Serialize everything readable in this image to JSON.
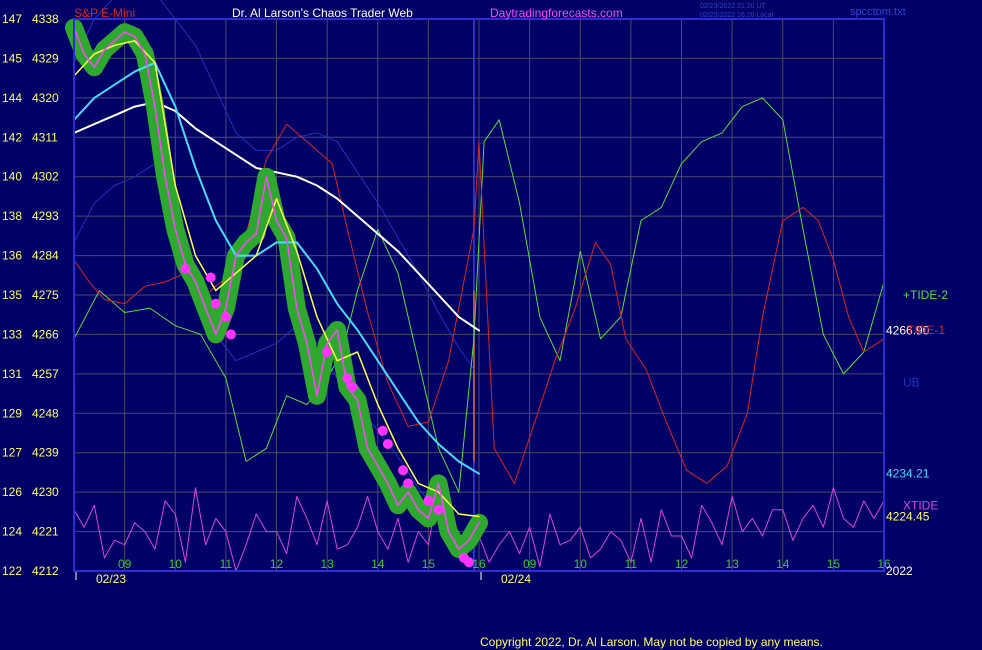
{
  "header": {
    "symbol": "S&P E-Mini",
    "title": "Dr. Al Larson's Chaos Trader Web",
    "site": "Daytradingforecasts.com",
    "stamp_line1": "02/23/2022 21:20 UT",
    "stamp_line2": "02/23/2022 16:20 Local",
    "file": "spcctom.txt"
  },
  "footer": {
    "copyright": "Copyright 2022, Dr. Al Larson. May not be copied by any means."
  },
  "colors": {
    "background": "#000066",
    "grid": "#4a4a6a",
    "frame": "#2b2bd8",
    "price": "#ff44ff",
    "price_glow": "#2ea82e",
    "ema_fast": "#ffff44",
    "ema_mid": "#44ddff",
    "ema_slow": "#ffffff",
    "band": "#2233bb",
    "tide_plus2": "#55dd44",
    "tide_minus1": "#dd2222",
    "xtide": "#dd44dd",
    "cursor": "#dd6622",
    "tick_text": "#ffff66",
    "hour_text": "#33cc33",
    "date_text": "#ffff66",
    "right_text": "#ffffff"
  },
  "chart_data": {
    "type": "line",
    "y_ticks": [
      {
        "index": "147",
        "price": "4338"
      },
      {
        "index": "145",
        "price": "4329"
      },
      {
        "index": "144",
        "price": "4320"
      },
      {
        "index": "142",
        "price": "4311"
      },
      {
        "index": "140",
        "price": "4302"
      },
      {
        "index": "138",
        "price": "4293"
      },
      {
        "index": "136",
        "price": "4284"
      },
      {
        "index": "135",
        "price": "4275"
      },
      {
        "index": "133",
        "price": "4266"
      },
      {
        "index": "131",
        "price": "4257"
      },
      {
        "index": "129",
        "price": "4248"
      },
      {
        "index": "127",
        "price": "4239"
      },
      {
        "index": "126",
        "price": "4230"
      },
      {
        "index": "124",
        "price": "4221"
      },
      {
        "index": "122",
        "price": "4212"
      }
    ],
    "ylim": [
      4212,
      4338
    ],
    "x_hour_ticks": [
      "09",
      "10",
      "11",
      "12",
      "13",
      "14",
      "15",
      "16",
      "09",
      "10",
      "11",
      "12",
      "13",
      "14",
      "15",
      "16"
    ],
    "x_dates": [
      "02/23",
      "02/24"
    ],
    "xlim": [
      8.0,
      24.0
    ],
    "now_x": 15.9,
    "legend": [
      {
        "label": "+TIDE-2",
        "color": "#55dd44"
      },
      {
        "label": "-TIDE-1",
        "color": "#dd2222"
      },
      {
        "label": "UB",
        "color": "#2233bb"
      },
      {
        "label": "XTIDE",
        "color": "#dd44dd"
      }
    ],
    "right_labels": [
      {
        "text": "4266.90",
        "value": 4266.9,
        "color": "#ffffff"
      },
      {
        "text": "4234.21",
        "value": 4234.21,
        "color": "#44ddff"
      },
      {
        "text": "4224.45",
        "value": 4224.45,
        "color": "#ffff66"
      },
      {
        "text": "2022",
        "value": 4212,
        "color": "#ffffff"
      }
    ],
    "series": [
      {
        "key": "price",
        "color": "#ff44ff",
        "x": [
          8.0,
          8.2,
          8.4,
          8.6,
          8.8,
          9.0,
          9.2,
          9.4,
          9.6,
          9.8,
          10.0,
          10.2,
          10.4,
          10.6,
          10.8,
          11.0,
          11.2,
          11.4,
          11.6,
          11.8,
          12.0,
          12.2,
          12.4,
          12.6,
          12.8,
          13.0,
          13.2,
          13.4,
          13.6,
          13.8,
          14.0,
          14.2,
          14.4,
          14.6,
          14.8,
          15.0,
          15.2,
          15.4,
          15.6,
          15.8,
          16.0
        ],
        "y": [
          4336,
          4330,
          4327,
          4331,
          4333,
          4335,
          4334,
          4330,
          4318,
          4302,
          4290,
          4282,
          4278,
          4272,
          4266,
          4272,
          4284,
          4287,
          4289,
          4302,
          4292,
          4288,
          4272,
          4264,
          4252,
          4264,
          4267,
          4254,
          4251,
          4240,
          4236,
          4232,
          4227,
          4230,
          4226,
          4224,
          4232,
          4221,
          4217,
          4219,
          4223
        ]
      },
      {
        "key": "ema_fast",
        "color": "#ffff44",
        "x": [
          8.0,
          8.4,
          8.8,
          9.2,
          9.6,
          10.0,
          10.4,
          10.8,
          11.2,
          11.6,
          12.0,
          12.4,
          12.8,
          13.2,
          13.6,
          14.0,
          14.4,
          14.8,
          15.2,
          15.6,
          16.0
        ],
        "y": [
          4325,
          4330,
          4332,
          4333,
          4328,
          4300,
          4284,
          4276,
          4280,
          4284,
          4297,
          4285,
          4270,
          4260,
          4262,
          4250,
          4240,
          4232,
          4230,
          4225,
          4224.45
        ]
      },
      {
        "key": "ema_mid",
        "color": "#44ddff",
        "x": [
          8.0,
          8.4,
          8.8,
          9.2,
          9.6,
          10.0,
          10.4,
          10.8,
          11.2,
          11.6,
          12.0,
          12.4,
          12.8,
          13.2,
          13.6,
          14.0,
          14.4,
          14.8,
          15.2,
          15.6,
          16.0
        ],
        "y": [
          4315,
          4320,
          4323,
          4326,
          4328,
          4318,
          4304,
          4292,
          4284,
          4284,
          4287,
          4287,
          4281,
          4273,
          4267,
          4260,
          4253,
          4246,
          4241,
          4237,
          4234.21
        ]
      },
      {
        "key": "ema_slow",
        "color": "#ffffff",
        "x": [
          8.0,
          8.4,
          8.8,
          9.2,
          9.6,
          10.0,
          10.4,
          10.8,
          11.2,
          11.6,
          12.0,
          12.4,
          12.8,
          13.2,
          13.6,
          14.0,
          14.4,
          14.8,
          15.2,
          15.6,
          16.0
        ],
        "y": [
          4312,
          4314,
          4316,
          4318,
          4319,
          4317,
          4313,
          4310,
          4307,
          4304,
          4303,
          4302,
          4300,
          4297,
          4293,
          4289,
          4285,
          4280,
          4275,
          4270,
          4266.9
        ]
      },
      {
        "key": "upper_band",
        "color": "#2233bb",
        "x": [
          8.0,
          8.4,
          8.8,
          9.2,
          9.6,
          10.0,
          10.4,
          10.8,
          11.2,
          11.6,
          12.0,
          12.4,
          12.8,
          13.2,
          13.6,
          14.0,
          14.4,
          14.8,
          15.2,
          15.6,
          15.9
        ],
        "y": [
          4328,
          4338,
          4343,
          4344,
          4344,
          4338,
          4332,
          4322,
          4312,
          4308,
          4308,
          4311,
          4312,
          4310,
          4303,
          4296,
          4288,
          4280,
          4271,
          4263,
          4258
        ]
      },
      {
        "key": "lower_band",
        "color": "#2233bb",
        "x": [
          8.0,
          8.4,
          8.8,
          9.2,
          9.6,
          10.0,
          10.4,
          10.8,
          11.2,
          11.6,
          12.0,
          12.4,
          12.8,
          13.2,
          13.6,
          14.0,
          14.4,
          14.8,
          15.2,
          15.6,
          15.9
        ],
        "y": [
          4287,
          4296,
          4300,
          4302,
          4305,
          4292,
          4276,
          4266,
          4260,
          4262,
          4264,
          4268,
          4264,
          4256,
          4250,
          4244,
          4238,
          4231,
          4225,
          4219,
          4216
        ]
      },
      {
        "key": "tide_plus2",
        "color": "#55dd44",
        "x": [
          8.0,
          8.5,
          9.0,
          9.5,
          10.0,
          10.5,
          11.0,
          11.4,
          11.8,
          12.2,
          12.6,
          13.0,
          13.3,
          13.6,
          14.0,
          14.4,
          14.8,
          15.2,
          15.6,
          15.9,
          16.1,
          16.4,
          16.8,
          17.2,
          17.6,
          18.0,
          18.4,
          18.8,
          19.2,
          19.6,
          20.0,
          20.4,
          20.8,
          21.2,
          21.6,
          22.0,
          22.4,
          22.8,
          23.2,
          23.6,
          24.0
        ],
        "y": [
          4265,
          4276,
          4271,
          4272,
          4268,
          4266,
          4256,
          4237,
          4240,
          4252,
          4250,
          4256,
          4262,
          4276,
          4290,
          4280,
          4260,
          4240,
          4230,
          4265,
          4310,
          4315,
          4296,
          4270,
          4260,
          4285,
          4265,
          4270,
          4292,
          4295,
          4305,
          4310,
          4312,
          4318,
          4320,
          4315,
          4290,
          4266,
          4257,
          4262,
          4278
        ]
      },
      {
        "key": "tide_minus1",
        "color": "#dd2222",
        "x": [
          8.0,
          8.3,
          8.6,
          9.0,
          9.4,
          9.8,
          10.2,
          10.6,
          11.0,
          11.4,
          11.8,
          12.2,
          12.5,
          12.8,
          13.1,
          13.4,
          13.8,
          14.2,
          14.6,
          15.0,
          15.4,
          15.9,
          16.0,
          16.3,
          16.7,
          17.1,
          17.5,
          17.9,
          18.3,
          18.6,
          18.9,
          19.3,
          19.7,
          20.1,
          20.5,
          20.9,
          21.3,
          21.6,
          22.0,
          22.4,
          22.7,
          23.0,
          23.3,
          23.6,
          24.0
        ],
        "y": [
          4283,
          4278,
          4274,
          4273,
          4277,
          4278,
          4280,
          4275,
          4279,
          4289,
          4306,
          4314,
          4311,
          4308,
          4305,
          4290,
          4271,
          4255,
          4245,
          4246,
          4260,
          4290,
          4310,
          4240,
          4232,
          4246,
          4260,
          4272,
          4287,
          4282,
          4265,
          4258,
          4246,
          4235,
          4232,
          4236,
          4248,
          4270,
          4292,
          4295,
          4292,
          4283,
          4270,
          4262,
          4265
        ]
      },
      {
        "key": "xtide",
        "color": "#dd44dd",
        "x": [
          8.0,
          8.2,
          8.4,
          8.6,
          8.8,
          9.0,
          9.2,
          9.4,
          9.6,
          9.8,
          10.0,
          10.2,
          10.4,
          10.6,
          10.8,
          11.0,
          11.2,
          11.4,
          11.6,
          11.8,
          12.0,
          12.2,
          12.4,
          12.6,
          12.8,
          13.0,
          13.2,
          13.4,
          13.6,
          13.8,
          14.0,
          14.2,
          14.4,
          14.6,
          14.8,
          15.0,
          15.2,
          15.4,
          15.6,
          15.8,
          16.0,
          16.2,
          16.4,
          16.6,
          16.8,
          17.0,
          17.2,
          17.4,
          17.6,
          17.8,
          18.0,
          18.2,
          18.4,
          18.6,
          18.8,
          19.0,
          19.2,
          19.4,
          19.6,
          19.8,
          20.0,
          20.2,
          20.4,
          20.6,
          20.8,
          21.0,
          21.2,
          21.4,
          21.6,
          21.8,
          22.0,
          22.2,
          22.4,
          22.6,
          22.8,
          23.0,
          23.2,
          23.4,
          23.6,
          23.8,
          24.0
        ],
        "y": [
          4226,
          4222,
          4227,
          4215,
          4219,
          4218,
          4223,
          4221,
          4217,
          4228,
          4225,
          4214,
          4231,
          4218,
          4224,
          4221,
          4212,
          4218,
          4225,
          4221,
          4221,
          4216,
          4229,
          4224,
          4218,
          4228,
          4217,
          4218,
          4222,
          4229,
          4221,
          4217,
          4224,
          4214,
          4221,
          4218,
          4231,
          4220,
          4217,
          4223,
          4220,
          4214,
          4218,
          4221,
          4216,
          4222,
          4213,
          4225,
          4218,
          4219,
          4222,
          4215,
          4217,
          4221,
          4219,
          4214,
          4224,
          4214,
          4226,
          4220,
          4220,
          4215,
          4227,
          4223,
          4218,
          4229,
          4221,
          4224,
          4220,
          4226,
          4226,
          4219,
          4224,
          4227,
          4222,
          4231,
          4224,
          4222,
          4228,
          4224,
          4228
        ]
      }
    ],
    "highlight_dots": {
      "color": "#ff33ff",
      "x": [
        10.2,
        10.7,
        10.8,
        11.0,
        11.1,
        13.0,
        13.4,
        13.5,
        14.1,
        14.2,
        14.5,
        14.6,
        15.0,
        15.2,
        15.7,
        15.8
      ],
      "y": [
        4281,
        4279,
        4273,
        4270,
        4266,
        4262,
        4256,
        4254,
        4244,
        4241,
        4235,
        4232,
        4228,
        4226,
        4215,
        4214
      ]
    }
  }
}
